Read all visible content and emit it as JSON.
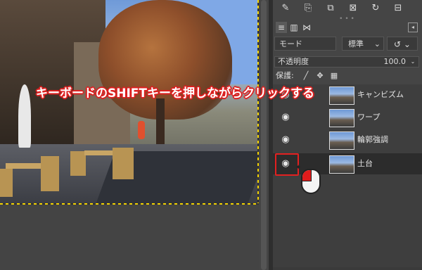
{
  "annotation": {
    "text": "キーボードのSHIFTキーを押しながらクリックする",
    "color": "#e32020"
  },
  "canvas": {
    "guide_color": "#f2d200"
  },
  "panel": {
    "toolbar_icons": [
      "edit-icon",
      "new-layer-icon",
      "duplicate-icon",
      "delete-icon",
      "refresh-icon",
      "reset-icon"
    ],
    "tabs": [
      "layers-tab-icon",
      "channels-tab-icon",
      "paths-tab-icon"
    ],
    "mode": {
      "label": "モード",
      "value": "標準"
    },
    "opacity": {
      "label": "不透明度",
      "value": "100.0"
    },
    "lock": {
      "label": "保護:"
    },
    "layers": [
      {
        "name": "キャンビズム",
        "visible": true,
        "selected": false
      },
      {
        "name": "ワープ",
        "visible": true,
        "selected": false
      },
      {
        "name": "輪郭強調",
        "visible": true,
        "selected": false
      },
      {
        "name": "土台",
        "visible": true,
        "selected": true
      }
    ]
  }
}
